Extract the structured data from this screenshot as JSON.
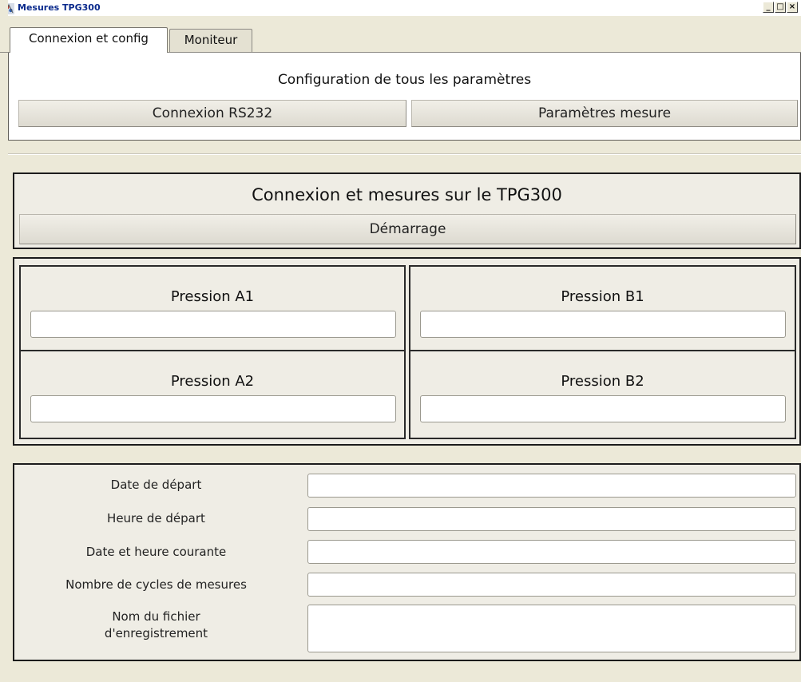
{
  "window": {
    "title": "Mesures TPG300",
    "app_icon": "app-icon",
    "controls": {
      "minimize": "_",
      "maximize": "□",
      "close": "×"
    }
  },
  "tabs": [
    {
      "label": "Connexion et config",
      "active": true
    },
    {
      "label": "Moniteur",
      "active": false
    }
  ],
  "config": {
    "title": "Configuration de tous les paramètres",
    "rs232_button": "Connexion RS232",
    "params_button": "Paramètres mesure"
  },
  "start": {
    "title": "Connexion et mesures sur le TPG300",
    "start_button": "Démarrage"
  },
  "pressures": {
    "a1": {
      "label": "Pression A1",
      "value": ""
    },
    "b1": {
      "label": "Pression B1",
      "value": ""
    },
    "a2": {
      "label": "Pression A2",
      "value": ""
    },
    "b2": {
      "label": "Pression B2",
      "value": ""
    }
  },
  "form": {
    "start_date": {
      "label": "Date de départ",
      "value": ""
    },
    "start_time": {
      "label": "Heure de départ",
      "value": ""
    },
    "current_datetime": {
      "label": "Date et heure courante",
      "value": ""
    },
    "cycle_count": {
      "label": "Nombre de cycles de mesures",
      "value": ""
    },
    "file_name": {
      "label_line1": "Nom du fichier",
      "label_line2": "d'enregistrement",
      "value": ""
    }
  }
}
